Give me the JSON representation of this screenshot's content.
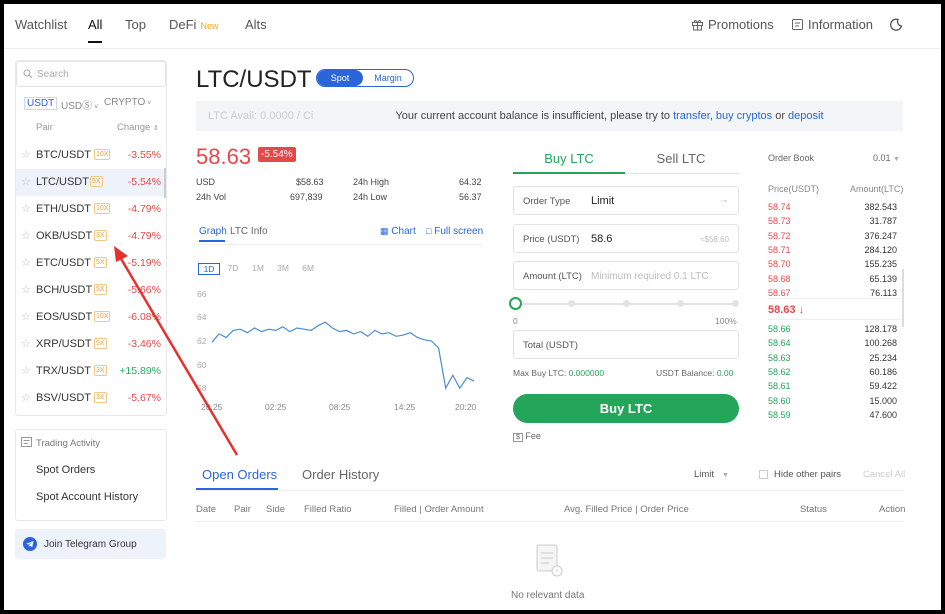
{
  "topnav": {
    "items": [
      "Watchlist",
      "All",
      "Top",
      "DeFi",
      "Alts"
    ],
    "defi_badge": "New",
    "promotions": "Promotions",
    "information": "Information"
  },
  "sidebar": {
    "search_placeholder": "Search",
    "quote_tabs": [
      "USDT",
      "USDⓈ",
      "CRYPTO"
    ],
    "col_pair": "Pair",
    "col_change": "Change",
    "pairs": [
      {
        "name": "BTC/USDT",
        "lev": "10X",
        "change": "-3.55%"
      },
      {
        "name": "LTC/USDT",
        "lev": "5X",
        "change": "-5.54%"
      },
      {
        "name": "ETH/USDT",
        "lev": "10X",
        "change": "-4.79%"
      },
      {
        "name": "OKB/USDT",
        "lev": "3X",
        "change": "-4.79%"
      },
      {
        "name": "ETC/USDT",
        "lev": "5X",
        "change": "-5.19%"
      },
      {
        "name": "BCH/USDT",
        "lev": "5X",
        "change": "-5.66%"
      },
      {
        "name": "EOS/USDT",
        "lev": "10X",
        "change": "-6.08%"
      },
      {
        "name": "XRP/USDT",
        "lev": "5X",
        "change": "-3.46%"
      },
      {
        "name": "TRX/USDT",
        "lev": "3X",
        "change": "+15.89%"
      },
      {
        "name": "BSV/USDT",
        "lev": "3X",
        "change": "-5.67%"
      }
    ],
    "trading_activity": "Trading Activity",
    "spot_orders": "Spot Orders",
    "spot_account_history": "Spot Account History",
    "telegram": "Join Telegram Group"
  },
  "main": {
    "pair": "LTC/USDT",
    "spot": "Spot",
    "margin": "Margin",
    "banner_faded": "LTC Avail: 0.0000 / Ci",
    "banner_text": "Your current account balance is insufficient, please try to",
    "banner_transfer": "transfer",
    "banner_buy": "buy cryptos",
    "banner_or": "or",
    "banner_deposit": "deposit",
    "price": "58.63",
    "change_pct": "-5.54%",
    "usd_label": "USD",
    "usd_value": "$58.63",
    "high_label": "24h High",
    "high_value": "64.32",
    "vol_label": "24h Vol",
    "vol_value": "697,839",
    "low_label": "24h Low",
    "low_value": "56.37",
    "graph_tab": "Graph",
    "info_tab": "LTC Info",
    "chart_link": "Chart",
    "fullscreen_link": "Full screen",
    "timeframes": [
      "1D",
      "7D",
      "1M",
      "3M",
      "6M"
    ]
  },
  "chart_data": {
    "type": "line",
    "x_ticks": [
      "20:25",
      "02:25",
      "08:25",
      "14:25",
      "20:20"
    ],
    "y_ticks": [
      66,
      64,
      62,
      60,
      58
    ],
    "ylim": [
      57,
      67
    ],
    "values": [
      61.9,
      62.6,
      62.3,
      62.9,
      63.0,
      62.7,
      63.1,
      62.8,
      63.0,
      62.9,
      63.2,
      62.8,
      63.1,
      63.0,
      62.9,
      63.3,
      63.6,
      63.1,
      62.8,
      62.9,
      62.6,
      62.8,
      62.4,
      62.9,
      62.6,
      62.7,
      62.4,
      62.5,
      62.7,
      62.3,
      62.1,
      62.0,
      61.4,
      58.0,
      59.1,
      58.0,
      58.9,
      58.6
    ],
    "color": "#4a8cd6"
  },
  "order": {
    "buy_tab": "Buy LTC",
    "sell_tab": "Sell LTC",
    "type_label": "Order Type",
    "type_value": "Limit",
    "price_label": "Price (USDT)",
    "price_value": "58.6",
    "price_hint": "≈$58.60",
    "amount_label": "Amount (LTC)",
    "amount_placeholder": "Minimum required 0.1 LTC",
    "slider_min": "0",
    "slider_max": "100%",
    "total_label": "Total (USDT)",
    "max_buy_label": "Max Buy LTC:",
    "max_buy_value": "0.000000",
    "balance_label": "USDT Balance:",
    "balance_value": "0.00",
    "buy_button": "Buy LTC",
    "fee": "Fee",
    "slider_level": 0
  },
  "orderbook": {
    "title": "Order Book",
    "precision": "0.01",
    "col_price": "Price(USDT)",
    "col_amount": "Amount(LTC)",
    "asks": [
      {
        "p": "58.74",
        "a": "382.543"
      },
      {
        "p": "58.73",
        "a": "31.787"
      },
      {
        "p": "58.72",
        "a": "376.247"
      },
      {
        "p": "58.71",
        "a": "284.120"
      },
      {
        "p": "58.70",
        "a": "155.235"
      },
      {
        "p": "58.68",
        "a": "65.139"
      },
      {
        "p": "58.67",
        "a": "76.113"
      }
    ],
    "last": "58.63",
    "bids": [
      {
        "p": "58.66",
        "a": "128.178"
      },
      {
        "p": "58.64",
        "a": "100.268"
      },
      {
        "p": "58.63",
        "a": "25.234"
      },
      {
        "p": "58.62",
        "a": "60.186"
      },
      {
        "p": "58.61",
        "a": "59.422"
      },
      {
        "p": "58.60",
        "a": "15.000"
      },
      {
        "p": "58.59",
        "a": "47.600"
      }
    ]
  },
  "orders": {
    "open_tab": "Open Orders",
    "history_tab": "Order History",
    "filter": "Limit",
    "hide_other": "Hide other pairs",
    "cancel_all": "Cancel All",
    "cols": [
      "Date",
      "Pair",
      "Side",
      "Filled Ratio",
      "Filled | Order Amount",
      "Avg. Filled Price | Order Price",
      "Status",
      "Action"
    ],
    "empty": "No relevant data"
  },
  "colors": {
    "accent": "#2a66d9",
    "red": "#e54848",
    "green": "#23a55a",
    "annotation_arrow": "#e53030"
  }
}
